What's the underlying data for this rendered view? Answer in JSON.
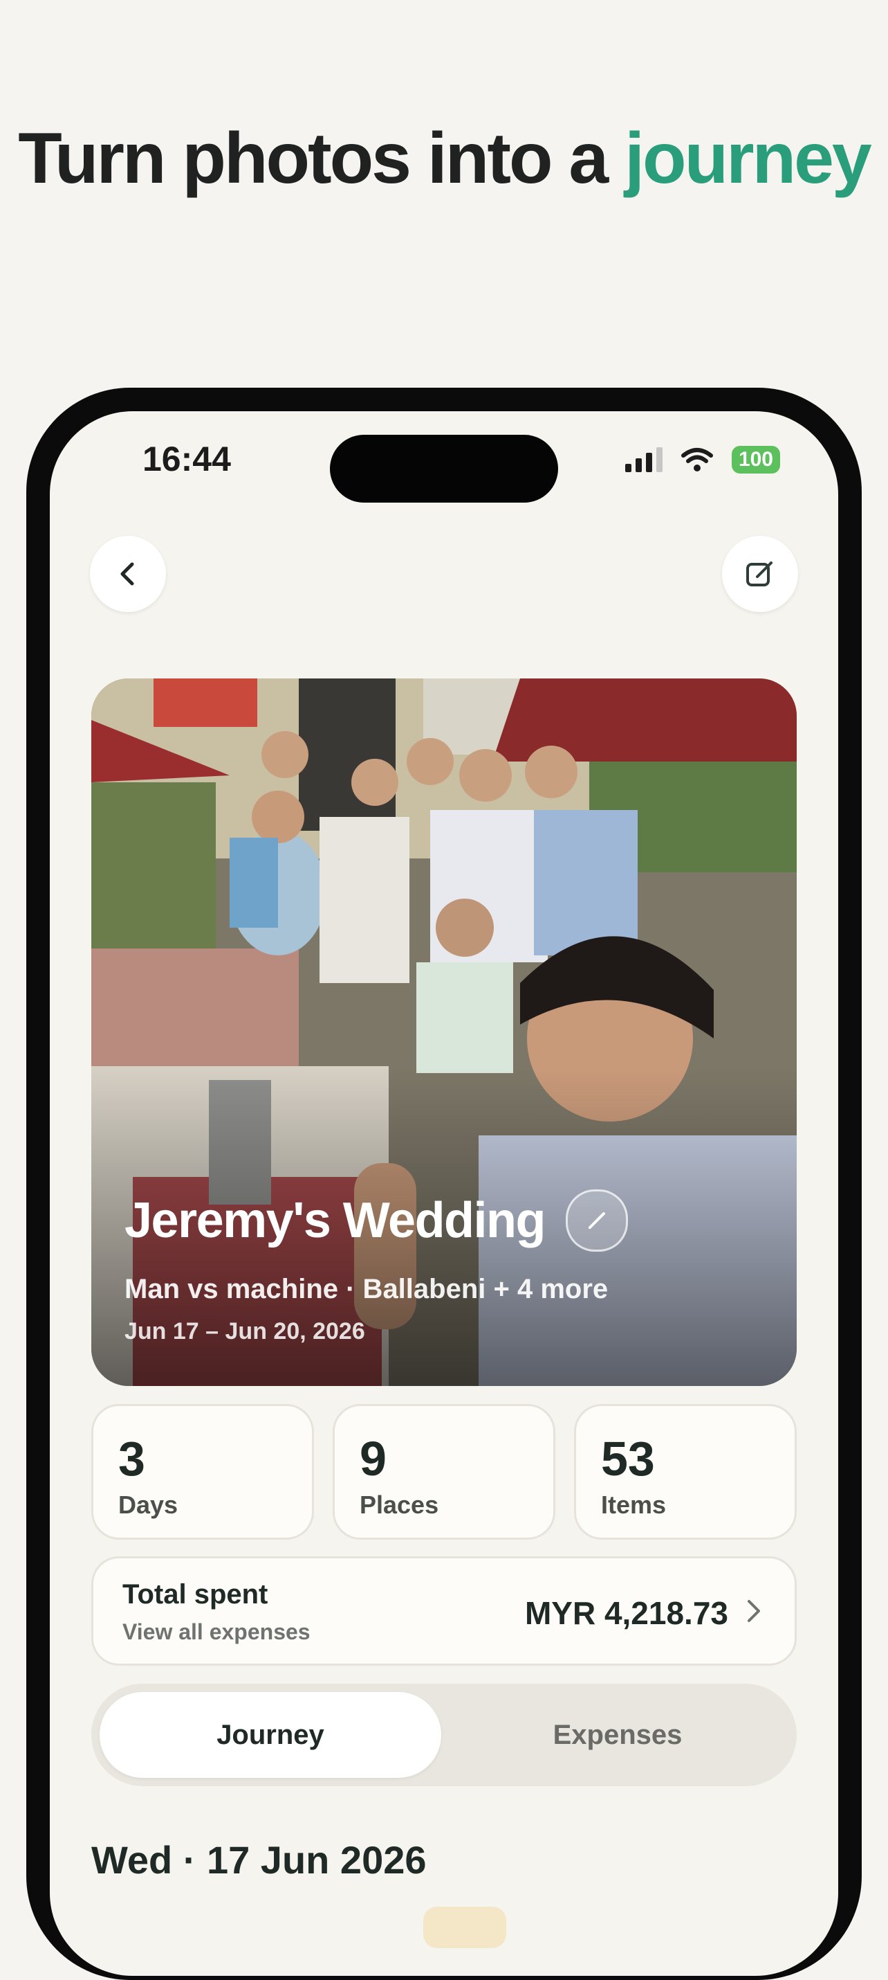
{
  "headline": {
    "part1": "Turn photos into a",
    "accent": "journey"
  },
  "status_bar": {
    "time": "16:44",
    "battery": "100"
  },
  "nav": {
    "back_icon": "chevron-left-icon",
    "edit_icon": "edit-square-icon"
  },
  "trip": {
    "title": "Jeremy's Wedding",
    "subtitle": "Man vs machine · Ballabeni + 4 more",
    "dates": "Jun 17 – Jun 20, 2026"
  },
  "stats": [
    {
      "value": "3",
      "label": "Days"
    },
    {
      "value": "9",
      "label": "Places"
    },
    {
      "value": "53",
      "label": "Items"
    }
  ],
  "spending": {
    "title": "Total spent",
    "link": "View all expenses",
    "amount": "MYR 4,218.73"
  },
  "tabs": [
    {
      "label": "Journey",
      "active": true
    },
    {
      "label": "Expenses",
      "active": false
    }
  ],
  "day_heading": "Wed · 17 Jun 2026",
  "colors": {
    "accent": "#2a9d7a",
    "battery": "#5cc05c",
    "background": "#f6f4ef"
  }
}
